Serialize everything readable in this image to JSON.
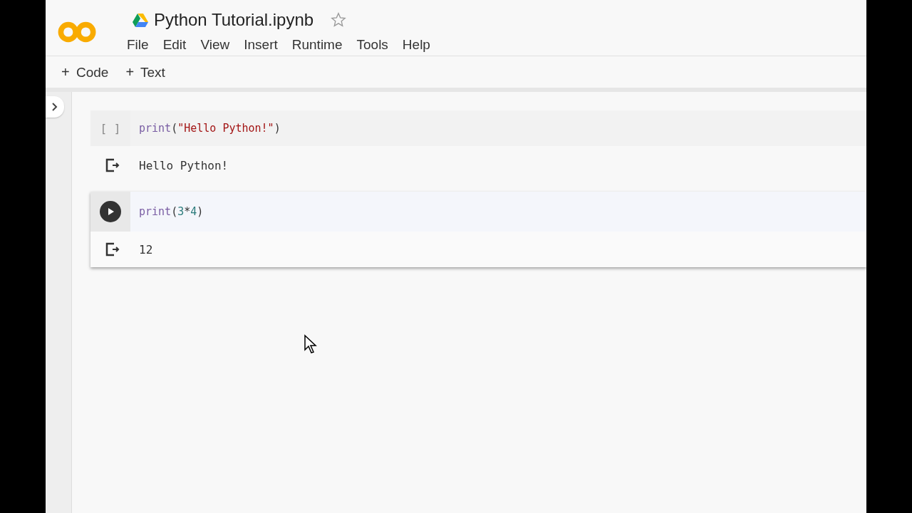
{
  "header": {
    "title": "Python Tutorial.ipynb",
    "starred": false,
    "menu": [
      "File",
      "Edit",
      "View",
      "Insert",
      "Runtime",
      "Tools",
      "Help"
    ]
  },
  "toolbar": [
    {
      "icon": "+",
      "label": "Code"
    },
    {
      "icon": "+",
      "label": "Text"
    }
  ],
  "sidebar": {
    "expanded": false
  },
  "cells": [
    {
      "selected": false,
      "prompt": "[ ]",
      "code": [
        {
          "kind": "builtin",
          "text": "print"
        },
        {
          "kind": "punct",
          "text": "("
        },
        {
          "kind": "string",
          "text": "\"Hello Python!\""
        },
        {
          "kind": "punct",
          "text": ")"
        }
      ],
      "output": "Hello Python!"
    },
    {
      "selected": true,
      "code": [
        {
          "kind": "builtin",
          "text": "print"
        },
        {
          "kind": "punct",
          "text": "("
        },
        {
          "kind": "number",
          "text": "3"
        },
        {
          "kind": "punct",
          "text": "*"
        },
        {
          "kind": "number",
          "text": "4"
        },
        {
          "kind": "punct",
          "text": ")"
        }
      ],
      "output": "12"
    }
  ]
}
